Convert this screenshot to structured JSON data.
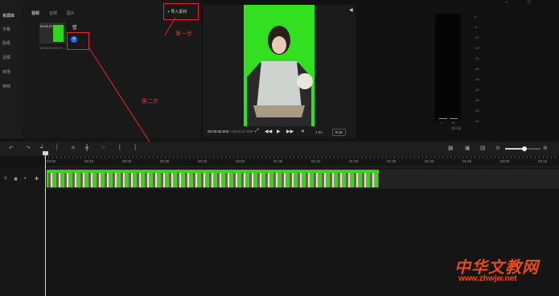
{
  "sidebar": {
    "items": [
      "资源库",
      "字幕",
      "贴纸",
      "滤镜",
      "转场",
      "特效"
    ],
    "active_index": 0
  },
  "media_panel": {
    "tabs": [
      "视频",
      "音频",
      "图片"
    ],
    "active_tab_index": 0,
    "import_label": "导入素材",
    "thumbnail": {
      "duration": "00:01:27",
      "filename": "5a9080bc9bb7d..."
    }
  },
  "annotations": {
    "step1": "第一步",
    "step2": "第二步",
    "color": "#e02a2a"
  },
  "preview": {
    "current_time": "00:00:00.000",
    "total_time": "00:01:27.500",
    "speed": "1.5x",
    "ratio": "9:16"
  },
  "meter": {
    "scale": [
      "0",
      "-6",
      "-12",
      "-18",
      "-24",
      "-30",
      "-36",
      "-42",
      "-48",
      "-54",
      "-60"
    ],
    "title": "电平表",
    "channel_labels": [
      "L",
      "R"
    ]
  },
  "timeline": {
    "ruler_ticks": [
      "00:00",
      "00:10",
      "00:20",
      "00:30",
      "00:40",
      "00:50",
      "01:00",
      "01:10",
      "01:20",
      "01:30",
      "01:40",
      "01:50",
      "02:00",
      "02:10"
    ],
    "zoom_level": 0.55
  },
  "watermark": {
    "brand": "中华文教网",
    "url": "www.zhwjw.net"
  },
  "colors": {
    "accent_blue": "#1d6ef0",
    "green_screen": "#33e01f",
    "meter_peak": "#d28a1e"
  }
}
